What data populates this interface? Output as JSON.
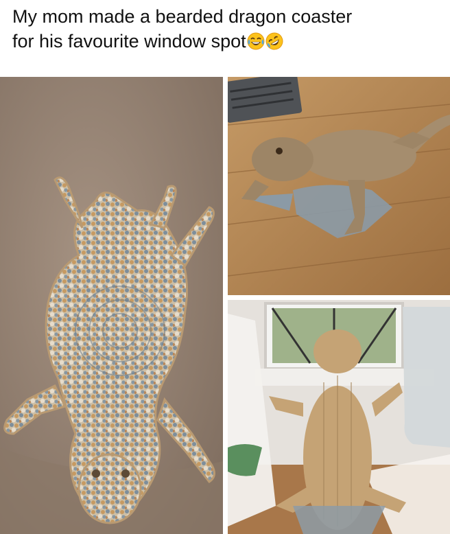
{
  "caption": {
    "line1": "My mom made a bearded dragon coaster",
    "line2": "for his favourite window spot",
    "emojis": [
      "face-with-tears-of-joy",
      "rolling-on-floor-laughing"
    ]
  },
  "photos": [
    {
      "name": "crochet-coaster-photo",
      "subject": "crocheted bearded dragon coaster on couch"
    },
    {
      "name": "dragon-on-coaster-photo",
      "subject": "bearded dragon standing on coaster on wood floor"
    },
    {
      "name": "dragon-at-window-photo",
      "subject": "bearded dragon on coaster looking out window"
    }
  ],
  "colors": {
    "couch": "#9a8676",
    "yarn_blue": "#7d8e9b",
    "yarn_tan": "#c69a62",
    "yarn_cream": "#e6dccb",
    "wood": "#b98a55",
    "dragon": "#b79a72"
  }
}
